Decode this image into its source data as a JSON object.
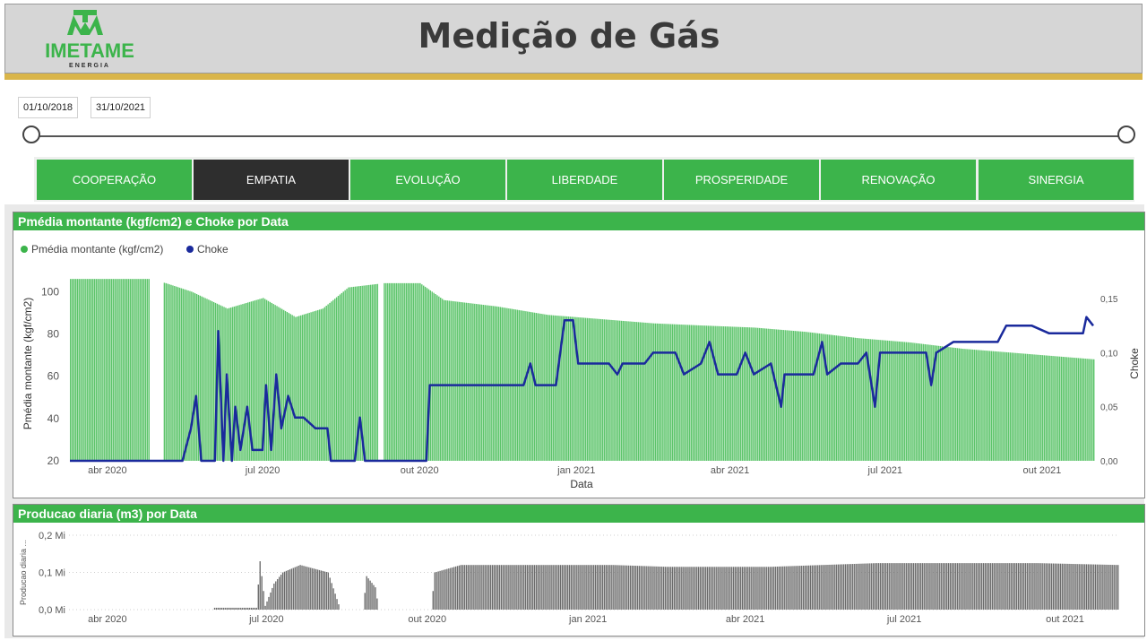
{
  "header": {
    "title": "Medição de Gás",
    "logo_text": "IMETAME",
    "logo_sub": "ENERGIA"
  },
  "filter": {
    "start_date": "01/10/2018",
    "end_date": "31/10/2021"
  },
  "tabs": [
    {
      "label": "COOPERAÇÃO",
      "active": false
    },
    {
      "label": "EMPATIA",
      "active": true
    },
    {
      "label": "EVOLUÇÃO",
      "active": false
    },
    {
      "label": "LIBERDADE",
      "active": false
    },
    {
      "label": "PROSPERIDADE",
      "active": false
    },
    {
      "label": "RENOVAÇÃO",
      "active": false
    },
    {
      "label": "SINERGIA",
      "active": false
    }
  ],
  "colors": {
    "green": "#3cb44b",
    "bar_green": "#5cc46a",
    "choke_blue": "#1a2a9c",
    "prod_gray": "#6b6b6b",
    "gold": "#d9b54a"
  },
  "chart_data": [
    {
      "type": "bar+line",
      "title": "Pmédia montante (kgf/cm2) e Choke por Data",
      "legend": [
        {
          "name": "Pmédia montante (kgf/cm2)",
          "color": "#3cb44b"
        },
        {
          "name": "Choke",
          "color": "#1a2a9c"
        }
      ],
      "legend_position": "top-left",
      "xlabel": "Data",
      "ylabel": "Pmédia montante (kgf/cm2)",
      "y2label": "Choke",
      "x_range": [
        "2020-03-10",
        "2021-10-31"
      ],
      "x_ticks": [
        "abr 2020",
        "jul 2020",
        "out 2020",
        "jan 2021",
        "abr 2021",
        "jul 2021",
        "out 2021"
      ],
      "y_ticks": [
        "20",
        "40",
        "60",
        "80",
        "100"
      ],
      "ylim": [
        20,
        112
      ],
      "y2_ticks": [
        "0,00",
        "0,05",
        "0,10",
        "0,15"
      ],
      "y2lim": [
        0,
        0.18
      ],
      "pressure_series": [
        [
          "2020-03-10",
          106
        ],
        [
          "2020-04-25",
          106
        ],
        [
          "2020-05-05",
          104
        ],
        [
          "2020-05-20",
          100
        ],
        [
          "2020-06-10",
          92
        ],
        [
          "2020-07-01",
          97
        ],
        [
          "2020-07-20",
          88
        ],
        [
          "2020-08-05",
          92
        ],
        [
          "2020-08-20",
          102
        ],
        [
          "2020-09-10",
          104
        ],
        [
          "2020-10-01",
          104
        ],
        [
          "2020-10-15",
          96
        ],
        [
          "2020-11-15",
          93
        ],
        [
          "2020-12-15",
          89
        ],
        [
          "2021-01-15",
          87
        ],
        [
          "2021-02-15",
          85
        ],
        [
          "2021-03-15",
          84
        ],
        [
          "2021-04-15",
          83
        ],
        [
          "2021-05-15",
          81
        ],
        [
          "2021-06-15",
          78
        ],
        [
          "2021-07-15",
          76
        ],
        [
          "2021-08-15",
          73
        ],
        [
          "2021-09-15",
          71
        ],
        [
          "2021-10-31",
          68
        ]
      ],
      "pressure_gaps": [
        [
          "2020-04-26",
          "2020-05-03"
        ],
        [
          "2020-09-07",
          "2020-09-09"
        ]
      ],
      "choke_series": [
        [
          "2020-03-10",
          0.0
        ],
        [
          "2020-05-15",
          0.0
        ],
        [
          "2020-05-20",
          0.03
        ],
        [
          "2020-05-23",
          0.06
        ],
        [
          "2020-05-26",
          0.0
        ],
        [
          "2020-06-03",
          0.0
        ],
        [
          "2020-06-05",
          0.12
        ],
        [
          "2020-06-08",
          0.0
        ],
        [
          "2020-06-10",
          0.08
        ],
        [
          "2020-06-13",
          0.0
        ],
        [
          "2020-06-15",
          0.05
        ],
        [
          "2020-06-18",
          0.01
        ],
        [
          "2020-06-22",
          0.05
        ],
        [
          "2020-06-25",
          0.01
        ],
        [
          "2020-07-01",
          0.01
        ],
        [
          "2020-07-03",
          0.07
        ],
        [
          "2020-07-06",
          0.01
        ],
        [
          "2020-07-09",
          0.08
        ],
        [
          "2020-07-12",
          0.03
        ],
        [
          "2020-07-16",
          0.06
        ],
        [
          "2020-07-20",
          0.04
        ],
        [
          "2020-07-25",
          0.04
        ],
        [
          "2020-08-01",
          0.03
        ],
        [
          "2020-08-08",
          0.03
        ],
        [
          "2020-08-10",
          0.0
        ],
        [
          "2020-08-24",
          0.0
        ],
        [
          "2020-08-27",
          0.04
        ],
        [
          "2020-08-30",
          0.0
        ],
        [
          "2020-10-05",
          0.0
        ],
        [
          "2020-10-07",
          0.07
        ],
        [
          "2020-12-01",
          0.07
        ],
        [
          "2020-12-05",
          0.09
        ],
        [
          "2020-12-08",
          0.07
        ],
        [
          "2020-12-20",
          0.07
        ],
        [
          "2020-12-25",
          0.13
        ],
        [
          "2020-12-30",
          0.13
        ],
        [
          "2021-01-02",
          0.09
        ],
        [
          "2021-01-20",
          0.09
        ],
        [
          "2021-01-25",
          0.08
        ],
        [
          "2021-01-28",
          0.09
        ],
        [
          "2021-02-10",
          0.09
        ],
        [
          "2021-02-15",
          0.1
        ],
        [
          "2021-02-28",
          0.1
        ],
        [
          "2021-03-05",
          0.08
        ],
        [
          "2021-03-15",
          0.09
        ],
        [
          "2021-03-20",
          0.11
        ],
        [
          "2021-03-25",
          0.08
        ],
        [
          "2021-04-05",
          0.08
        ],
        [
          "2021-04-10",
          0.1
        ],
        [
          "2021-04-15",
          0.08
        ],
        [
          "2021-04-25",
          0.09
        ],
        [
          "2021-05-01",
          0.05
        ],
        [
          "2021-05-03",
          0.08
        ],
        [
          "2021-05-20",
          0.08
        ],
        [
          "2021-05-25",
          0.11
        ],
        [
          "2021-05-28",
          0.08
        ],
        [
          "2021-06-05",
          0.09
        ],
        [
          "2021-06-15",
          0.09
        ],
        [
          "2021-06-20",
          0.1
        ],
        [
          "2021-06-25",
          0.05
        ],
        [
          "2021-06-28",
          0.1
        ],
        [
          "2021-07-10",
          0.1
        ],
        [
          "2021-07-25",
          0.1
        ],
        [
          "2021-07-28",
          0.07
        ],
        [
          "2021-07-31",
          0.1
        ],
        [
          "2021-08-10",
          0.11
        ],
        [
          "2021-08-25",
          0.11
        ],
        [
          "2021-09-05",
          0.11
        ],
        [
          "2021-09-10",
          0.125
        ],
        [
          "2021-09-25",
          0.125
        ],
        [
          "2021-10-05",
          0.118
        ],
        [
          "2021-10-25",
          0.118
        ],
        [
          "2021-10-27",
          0.133
        ],
        [
          "2021-10-31",
          0.125
        ]
      ]
    },
    {
      "type": "bar",
      "title": "Producao diaria (m3) por Data",
      "xlabel": "",
      "ylabel": "Producao diaria ...",
      "x_range": [
        "2020-03-10",
        "2021-10-31"
      ],
      "x_ticks": [
        "abr 2020",
        "jul 2020",
        "out 2020",
        "jan 2021",
        "abr 2021",
        "jul 2021",
        "out 2021"
      ],
      "y_ticks": [
        "0,0 Mi",
        "0,1 Mi",
        "0,2 Mi"
      ],
      "ylim": [
        0,
        0.2
      ],
      "grid": true,
      "series": [
        [
          "2020-06-01",
          0.005
        ],
        [
          "2020-06-25",
          0.005
        ],
        [
          "2020-06-27",
          0.13
        ],
        [
          "2020-06-30",
          0.01
        ],
        [
          "2020-07-05",
          0.07
        ],
        [
          "2020-07-10",
          0.1
        ],
        [
          "2020-07-20",
          0.12
        ],
        [
          "2020-08-05",
          0.1
        ],
        [
          "2020-08-12",
          0.0
        ],
        [
          "2020-08-25",
          0.0
        ],
        [
          "2020-08-27",
          0.09
        ],
        [
          "2020-09-01",
          0.06
        ],
        [
          "2020-09-03",
          0.0
        ],
        [
          "2020-10-03",
          0.0
        ],
        [
          "2020-10-05",
          0.1
        ],
        [
          "2020-10-20",
          0.12
        ],
        [
          "2020-11-05",
          0.12
        ],
        [
          "2020-12-15",
          0.12
        ],
        [
          "2021-01-15",
          0.12
        ],
        [
          "2021-02-15",
          0.115
        ],
        [
          "2021-03-15",
          0.115
        ],
        [
          "2021-04-15",
          0.115
        ],
        [
          "2021-05-15",
          0.12
        ],
        [
          "2021-06-15",
          0.125
        ],
        [
          "2021-07-15",
          0.125
        ],
        [
          "2021-08-15",
          0.125
        ],
        [
          "2021-09-15",
          0.125
        ],
        [
          "2021-10-31",
          0.12
        ]
      ]
    }
  ]
}
